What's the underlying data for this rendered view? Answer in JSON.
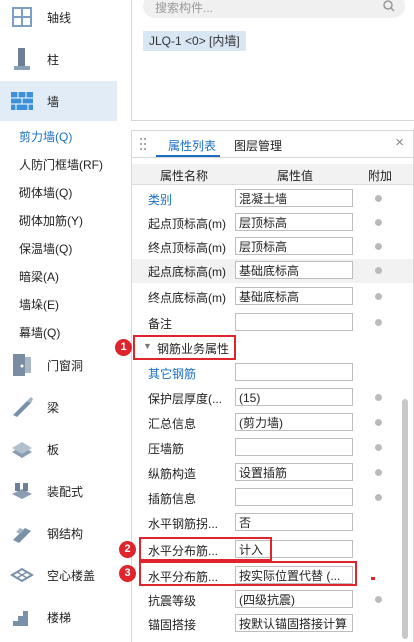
{
  "left_nav": {
    "categories": [
      {
        "label": "轴线",
        "icon": "axis-grid-icon"
      },
      {
        "label": "柱",
        "icon": "column-icon"
      },
      {
        "label": "墙",
        "icon": "wall-icon"
      },
      {
        "label": "门窗洞",
        "icon": "door-window-icon"
      },
      {
        "label": "梁",
        "icon": "beam-icon"
      },
      {
        "label": "板",
        "icon": "slab-icon"
      },
      {
        "label": "装配式",
        "icon": "prefab-icon"
      },
      {
        "label": "钢结构",
        "icon": "steel-structure-icon"
      },
      {
        "label": "空心楼盖",
        "icon": "hollow-floor-icon"
      },
      {
        "label": "楼梯",
        "icon": "stairs-icon"
      }
    ],
    "wall_subitems": [
      "剪力墙(Q)",
      "人防门框墙(RF)",
      "砌体墙(Q)",
      "砌体加筋(Y)",
      "保温墙(Q)",
      "暗梁(A)",
      "墙垛(E)",
      "幕墙(Q)"
    ]
  },
  "search": {
    "placeholder": "搜索构件..."
  },
  "component_chip": "JLQ-1 <0> [内墙]",
  "properties": {
    "tabs": [
      "属性列表",
      "图层管理"
    ],
    "headers": {
      "name": "属性名称",
      "value": "属性值",
      "extra": "附加"
    },
    "rows_top": [
      {
        "name": "类别",
        "value": "混凝土墙"
      },
      {
        "name": "起点顶标高(m)",
        "value": "层顶标高"
      },
      {
        "name": "终点顶标高(m)",
        "value": "层顶标高"
      },
      {
        "name": "起点底标高(m)",
        "value": "基础底标高"
      },
      {
        "name": "终点底标高(m)",
        "value": "基础底标高"
      },
      {
        "name": "备注",
        "value": ""
      }
    ],
    "section_label": "钢筋业务属性",
    "rows_bottom": [
      {
        "name": "其它钢筋",
        "value": ""
      },
      {
        "name": "保护层厚度(...",
        "value": "(15)"
      },
      {
        "name": "汇总信息",
        "value": "(剪力墙)"
      },
      {
        "name": "压墙筋",
        "value": ""
      },
      {
        "name": "纵筋构造",
        "value": "设置插筋"
      },
      {
        "name": "插筋信息",
        "value": ""
      },
      {
        "name": "水平钢筋拐...",
        "value": "否"
      },
      {
        "name": "水平分布筋...",
        "value": "计入"
      },
      {
        "name": "水平分布筋...",
        "value": "按实际位置代替 (..."
      },
      {
        "name": "抗震等级",
        "value": "(四级抗震)"
      },
      {
        "name": "锚固搭接",
        "value": "按默认锚固搭接计算"
      }
    ]
  },
  "badges": [
    "1",
    "2",
    "3"
  ]
}
